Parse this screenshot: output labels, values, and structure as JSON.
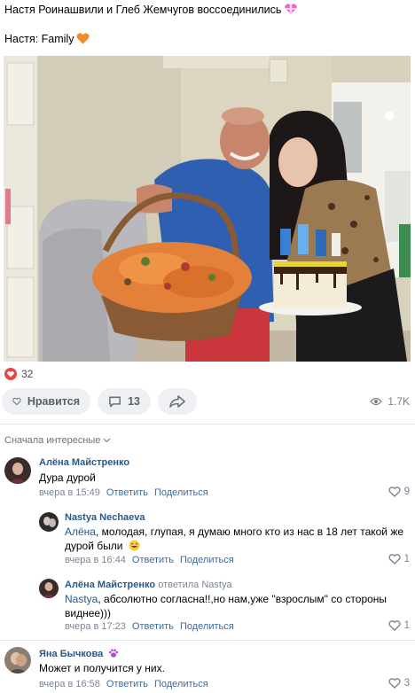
{
  "post": {
    "line1": "Настя Роинашвили и Глеб Жемчугов воссоединились",
    "line2": "Настя: Family"
  },
  "icons": {
    "line1_emoji": "gift-heart-icon",
    "line2_emoji": "orange-heart-icon"
  },
  "stats": {
    "likes": "32",
    "like_label": "Нравится",
    "comments": "13",
    "views": "1.7K"
  },
  "comments_header": {
    "sort_label": "Сначала интересные"
  },
  "comments": [
    {
      "author": "Алёна Майстренко",
      "text": "Дура дурой",
      "time": "вчера в 15:49",
      "reply": "Ответить",
      "share": "Поделиться",
      "likes": "9"
    },
    {
      "author": "Nastya Nechaeva",
      "mention": "Алёна",
      "text_line1": ", молодая, глупая, я думаю много кто из нас в 18 лет такой же",
      "text_line2": "дурой были",
      "time": "вчера в 16:44",
      "reply": "Ответить",
      "share": "Поделиться",
      "likes": "1"
    },
    {
      "author": "Алёна Майстренко",
      "replied_to": "ответила Nastya",
      "mention": "Nastya",
      "text_line1": ", абсолютно согласна!!,но нам,уже \"взрослым\" со стороны",
      "text_line2": "виднее)))",
      "time": "вчера в 17:23",
      "reply": "Ответить",
      "share": "Поделиться",
      "likes": "1"
    },
    {
      "author": "Яна Бычкова",
      "text": "Может и получится у них.",
      "time": "вчера в 16:58",
      "reply": "Ответить",
      "share": "Поделиться",
      "likes": "3"
    }
  ],
  "colors": {
    "link": "#2a5885",
    "like_red": "#e64646",
    "pill_bg": "#eef0f3"
  }
}
